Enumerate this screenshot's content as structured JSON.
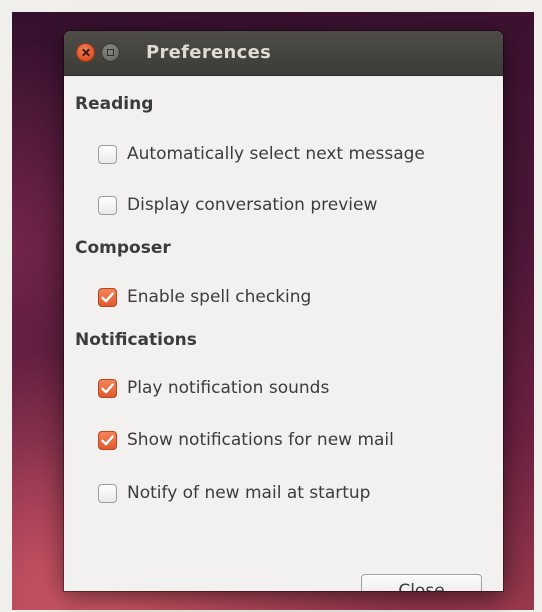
{
  "window": {
    "title": "Preferences"
  },
  "sections": [
    {
      "heading": "Reading",
      "options": [
        {
          "label": "Automatically select next message",
          "checked": false
        },
        {
          "label": "Display conversation preview",
          "checked": false
        }
      ]
    },
    {
      "heading": "Composer",
      "options": [
        {
          "label": "Enable spell checking",
          "checked": true
        }
      ]
    },
    {
      "heading": "Notifications",
      "options": [
        {
          "label": "Play notification sounds",
          "checked": true
        },
        {
          "label": "Show notifications for new mail",
          "checked": true
        },
        {
          "label": "Notify of new mail at startup",
          "checked": false
        }
      ]
    }
  ],
  "buttons": {
    "close_label": "Close"
  },
  "colors": {
    "accent": "#e05a2f",
    "titlebar": "#3d3c38",
    "window_bg": "#f2f1f0"
  }
}
